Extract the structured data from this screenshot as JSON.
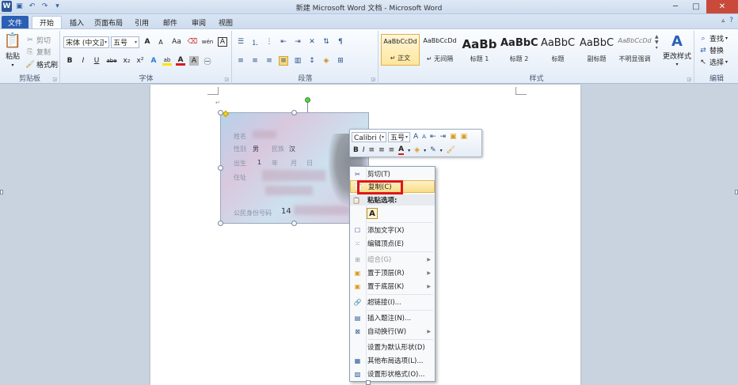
{
  "window": {
    "title": "新建 Microsoft Word 文档 - Microsoft Word",
    "logo": "W"
  },
  "quick_access": {
    "icons": [
      "save-icon",
      "undo-icon",
      "redo-icon",
      "customize-icon"
    ]
  },
  "tabs": [
    "文件",
    "开始",
    "插入",
    "页面布局",
    "引用",
    "邮件",
    "审阅",
    "视图"
  ],
  "clipboard": {
    "paste": "粘贴",
    "cut": "剪切",
    "copy": "复制",
    "format_painter": "格式刷",
    "label": "剪贴板"
  },
  "font": {
    "font_name": "宋体 (中文正文)",
    "font_size": "五号",
    "label": "字体",
    "font_color": "#e01717",
    "highlight_color": "#ffe400",
    "row1_glyphs": [
      "A",
      "A",
      "Aa",
      "wén",
      "A"
    ],
    "row2_glyphs": [
      "B",
      "I",
      "U",
      "abe",
      "x₂",
      "x²",
      "A",
      "ab",
      "A",
      "A",
      "㊀"
    ]
  },
  "paragraph": {
    "label": "段落"
  },
  "styles": {
    "label": "样式",
    "items": [
      {
        "preview": "AaBbCcDd",
        "name": "↵ 正文"
      },
      {
        "preview": "AaBbCcDd",
        "name": "↵ 无间隔"
      },
      {
        "preview": "AaBb",
        "name": "标题 1"
      },
      {
        "preview": "AaBbC",
        "name": "标题 2"
      },
      {
        "preview": "AaBbC",
        "name": "标题"
      },
      {
        "preview": "AaBbC",
        "name": "副标题"
      },
      {
        "preview": "AaBbCcDd",
        "name": "不明显强调"
      }
    ],
    "change_styles": "更改样式"
  },
  "editing": {
    "label": "编辑",
    "find": "查找",
    "replace": "替换",
    "select": "选择"
  },
  "id_card": {
    "labels": [
      "姓名",
      "性别",
      "民族",
      "出生",
      "年",
      "月",
      "日",
      "住址",
      "公民身份号码"
    ],
    "values": [
      "男",
      "汉",
      "1",
      "14"
    ]
  },
  "mini_toolbar": {
    "font_name": "Calibri (西",
    "font_size": "五号"
  },
  "context_menu": {
    "items": [
      {
        "icon": "✂",
        "label": "剪切(T)"
      },
      {
        "icon": "📄",
        "label": "复制(C)"
      },
      {
        "icon": "📋",
        "label": "粘贴选项:"
      },
      {
        "icon": "A",
        "label": ""
      },
      {
        "icon": "☐",
        "label": "添加文字(X)"
      },
      {
        "icon": "⁙",
        "label": "编辑顶点(E)"
      },
      {
        "icon": "⊞",
        "label": "组合(G)"
      },
      {
        "icon": "▣",
        "label": "置于顶层(R)"
      },
      {
        "icon": "▣",
        "label": "置于底层(K)"
      },
      {
        "icon": "🔗",
        "label": "超链接(I)..."
      },
      {
        "icon": "▤",
        "label": "插入题注(N)..."
      },
      {
        "icon": "⊠",
        "label": "自动换行(W)"
      },
      {
        "icon": "",
        "label": "设置为默认形状(D)"
      },
      {
        "icon": "▦",
        "label": "其他布局选项(L)..."
      },
      {
        "icon": "▨",
        "label": "设置形状格式(O)..."
      }
    ]
  },
  "colors": {
    "highlight_box": "#e01717",
    "file_tab": "#2b5fb4"
  }
}
